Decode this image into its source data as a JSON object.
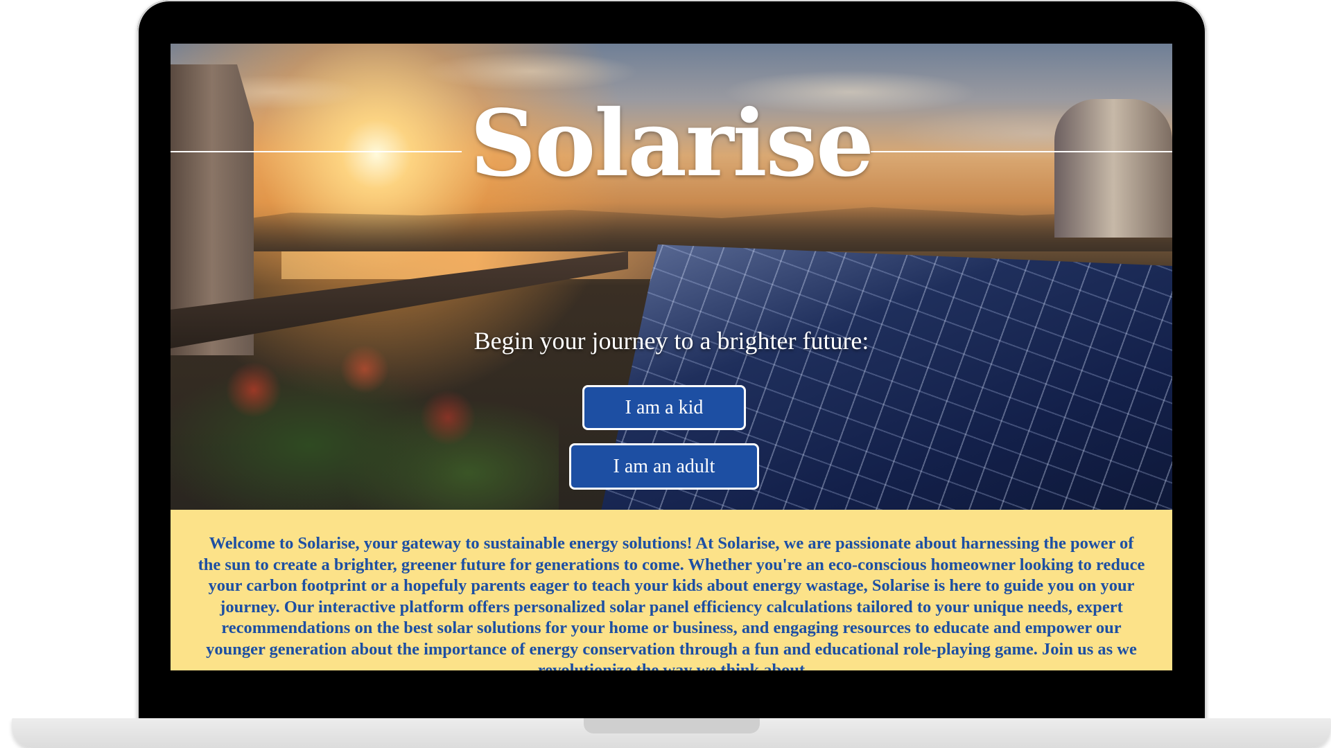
{
  "hero": {
    "title": "Solarise",
    "tagline": "Begin your journey to a brighter future:",
    "buttons": {
      "kid": "I am a kid",
      "adult": "I am an adult"
    }
  },
  "about": {
    "text": "Welcome to Solarise, your gateway to sustainable energy solutions! At Solarise, we are passionate about harnessing the power of the sun to create a brighter, greener future for generations to come. Whether you're an eco-conscious homeowner looking to reduce your carbon footprint or a hopefuly parents eager to teach your kids about energy wastage, Solarise is here to guide you on your journey. Our interactive platform offers personalized solar panel efficiency calculations tailored to your unique needs, expert recommendations on the best solar solutions for your home or business, and engaging resources to educate and empower our younger generation about the importance of energy conservation through a fun and educational role-playing game. Join us as we revolutionize the way we think about"
  },
  "colors": {
    "accent_blue": "#1d4fa3",
    "about_background": "#fce289",
    "button_border": "#ffffff"
  }
}
